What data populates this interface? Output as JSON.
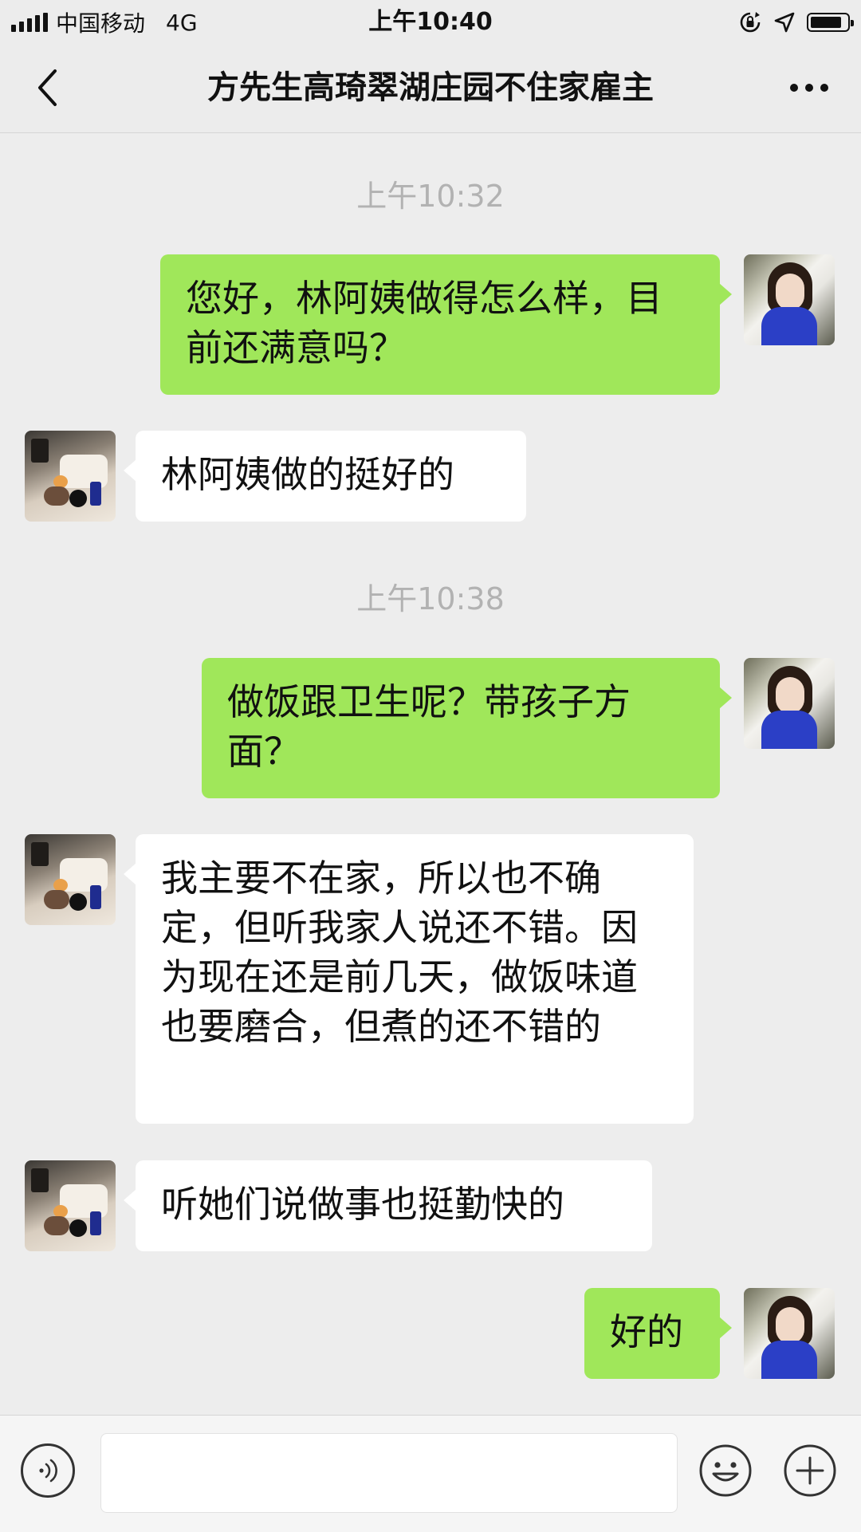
{
  "status_bar": {
    "carrier": "中国移动",
    "network": "4G",
    "time": "上午10:40"
  },
  "header": {
    "title": "方先生高琦翠湖庄园不住家雇主"
  },
  "messages": [
    {
      "type": "timestamp",
      "text": "上午10:32"
    },
    {
      "type": "sent",
      "text": "您好，林阿姨做得怎么样，目前还满意吗？"
    },
    {
      "type": "received",
      "text": "林阿姨做的挺好的"
    },
    {
      "type": "timestamp",
      "text": "上午10:38"
    },
    {
      "type": "sent",
      "text": "做饭跟卫生呢？带孩子方面？"
    },
    {
      "type": "received",
      "text": "我主要不在家，所以也不确定，但听我家人说还不错。因为现在还是前几天，做饭味道也要磨合，但煮的还不错的"
    },
    {
      "type": "received",
      "text": "听她们说做事也挺勤快的"
    },
    {
      "type": "sent",
      "text": "好的"
    }
  ],
  "input_bar": {
    "text_value": "",
    "icons": [
      "voice-icon",
      "emoji-icon",
      "plus-icon"
    ]
  },
  "colors": {
    "sent_bubble": "#a0e75a",
    "received_bubble": "#ffffff",
    "background": "#ededed",
    "timestamp": "#b2b2b2"
  }
}
